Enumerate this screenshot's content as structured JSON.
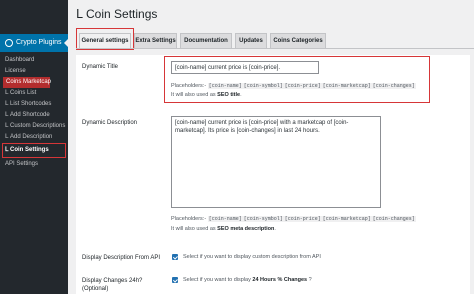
{
  "sidebar": {
    "items": [
      {
        "label": "Dashboard"
      },
      {
        "label": "License"
      },
      {
        "label": "Coins Marketcap"
      },
      {
        "label": "ᒪ Coins List"
      },
      {
        "label": "ᒪ List Shortcodes"
      },
      {
        "label": "ᒪ Add Shortcode"
      },
      {
        "label": "ᒪ Custom Descriptions"
      },
      {
        "label": "ᒪ Add Description"
      },
      {
        "label": "ᒪ Coin Settings"
      },
      {
        "label": "API Settings"
      }
    ],
    "menu_head": "Crypto Plugins"
  },
  "page": {
    "title": "ᒪ Coin Settings"
  },
  "tabs": [
    {
      "label": "General settings"
    },
    {
      "label": "Extra Settings"
    },
    {
      "label": "Documentation"
    },
    {
      "label": "Updates"
    },
    {
      "label": "Coins Categories"
    }
  ],
  "form": {
    "dynamic_title": {
      "label": "Dynamic Title",
      "value": "[coin-name] current price is [coin-price].",
      "placeholders_label": "Placeholders:-",
      "placeholders": [
        "[coin-name]",
        "[coin-symbol]",
        "[coin-price]",
        "[coin-marketcap]",
        "[coin-changes]"
      ],
      "seo_note_prefix": "It will also used as ",
      "seo_note_bold": "SEO title",
      "seo_note_suffix": "."
    },
    "dynamic_description": {
      "label": "Dynamic Description",
      "value": "[coin-name] current price is [coin-price] with a marketcap of [coin-marketcap]. Its price is [coin-changes] in last 24 hours.",
      "placeholders_label": "Placeholders:-",
      "placeholders": [
        "[coin-name]",
        "[coin-symbol]",
        "[coin-price]",
        "[coin-marketcap]",
        "[coin-changes]"
      ],
      "seo_note_prefix": "It will also used as ",
      "seo_note_bold": "SEO meta description",
      "seo_note_suffix": "."
    },
    "display_description": {
      "label": "Display Description From API",
      "help": "Select if you want to display custom description from API"
    },
    "display_changes": {
      "label": "Display Changes 24h?",
      "label_sub": "(Optional)",
      "help_prefix": "Select if you want to display ",
      "help_bold": "24 Hours % Changes",
      "help_suffix": " ?"
    }
  },
  "colors": {
    "accent": "#0073aa",
    "highlight": "#d63638",
    "marketcap": "#b32d2e",
    "sidebar": "#23282d"
  }
}
